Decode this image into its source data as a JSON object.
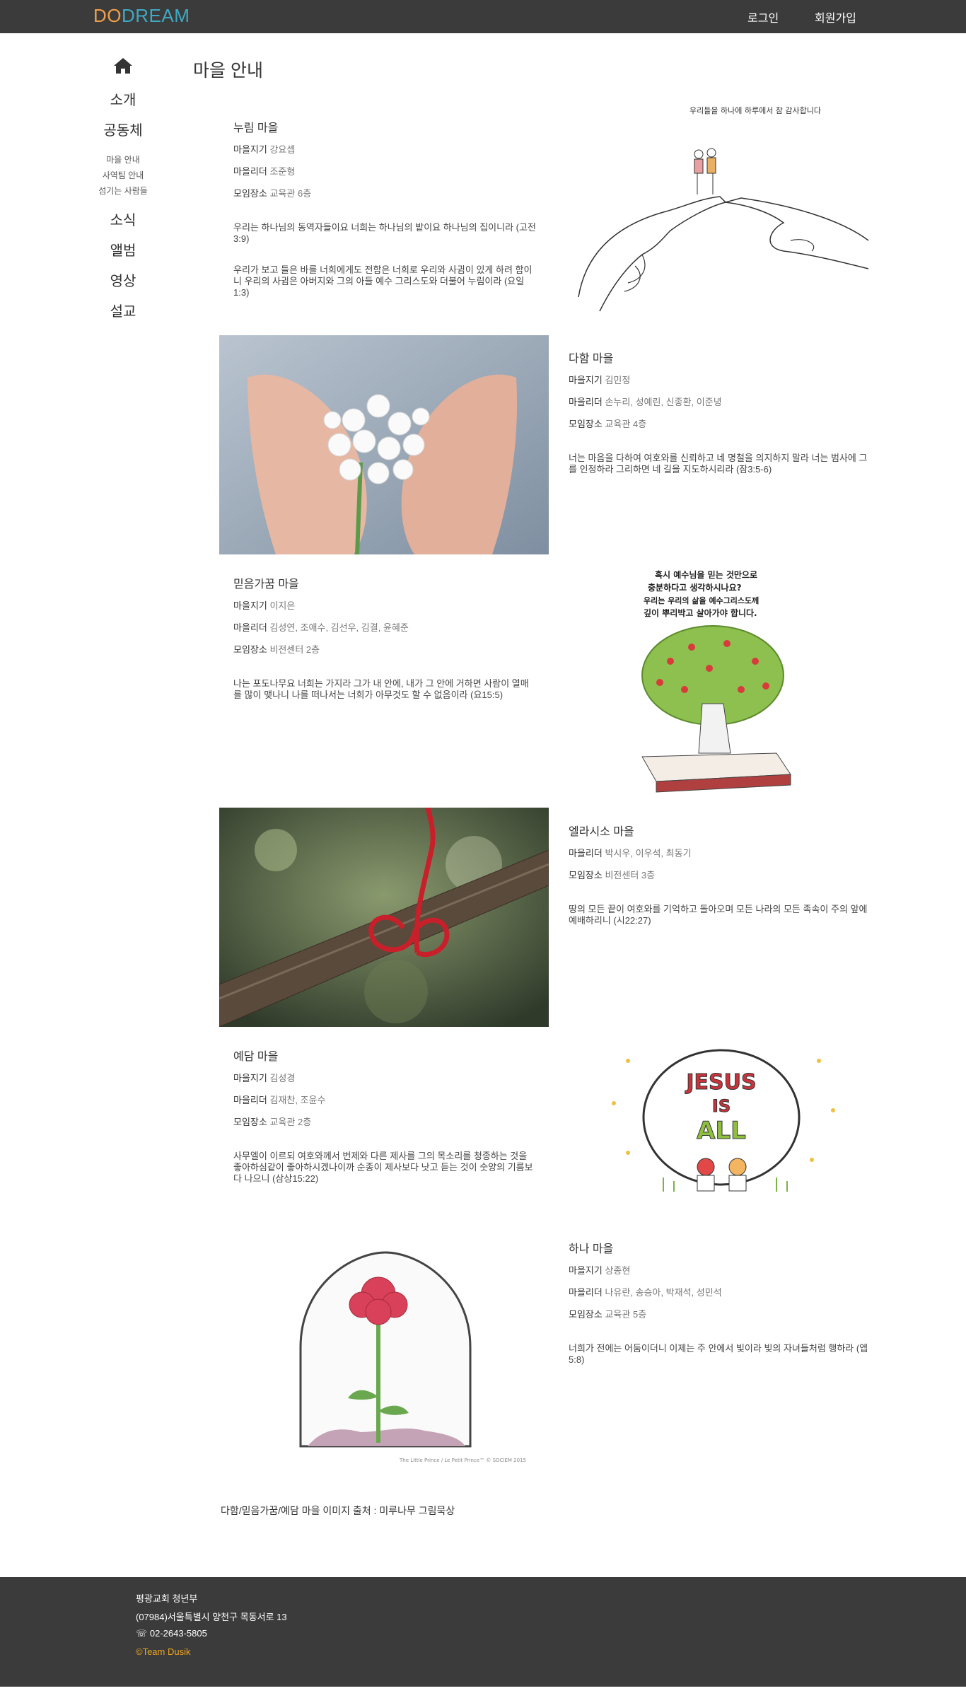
{
  "nav": {
    "logo_part1": "DO",
    "logo_part2": "DREAM",
    "login": "로그인",
    "signup": "회원가입"
  },
  "sidebar": {
    "home_icon": "home-icon",
    "items": [
      {
        "label": "소개"
      },
      {
        "label": "공동체"
      },
      {
        "label": "소식"
      },
      {
        "label": "앨범"
      },
      {
        "label": "영상"
      },
      {
        "label": "설교"
      }
    ],
    "sub": [
      {
        "label": "마을 안내"
      },
      {
        "label": "사역팀 안내"
      },
      {
        "label": "섬기는 사람들"
      }
    ]
  },
  "page_title": "마을 안내",
  "labels": {
    "leader1": "마을지기",
    "leader2": "마을리더",
    "place": "모임장소"
  },
  "villages": [
    {
      "name": "누림 마을",
      "keeper": "강요셉",
      "leaders": "조준형",
      "place": "교육관 6층",
      "verse1": "우리는 하나님의 동역자들이요 너희는 하나님의 밭이요 하나님의 집이니라 (고전3:9)",
      "verse2": "우리가 보고 들은 바를 너희에게도 전함은 너희로 우리와 사귐이 있게 하려 함이니 우리의 사귐은 아버지와 그의 아들 예수 그리스도와 더불어 누림이라 (요일1:3)"
    },
    {
      "name": "다함 마을",
      "keeper": "김민정",
      "leaders": "손누리, 성예린, 신종환, 이준녕",
      "place": "교육관 4층",
      "verse1": "너는 마음을 다하여 여호와를 신뢰하고 네 명철을 의지하지 말라 너는 범사에 그를 인정하라 그리하면 네 길을 지도하시리라 (잠3:5-6)"
    },
    {
      "name": "믿음가꿈 마을",
      "keeper": "이지은",
      "leaders": "김성연, 조애수, 김선우, 김결, 윤혜준",
      "place": "비전센터 2층",
      "verse1": "나는 포도나무요 너희는 가지라 그가 내 안에, 내가 그 안에 거하면 사람이 열매를 많이 맺나니 나를 떠나서는 너희가 아무것도 할 수 없음이라 (요15:5)"
    },
    {
      "name": "엘라시소 마을",
      "leaders": "박시우, 이우석, 최동기",
      "place": "비전센터 3층",
      "verse1": "땅의 모든 끝이 여호와를 기억하고 돌아오며 모든 나라의 모든 족속이 주의 앞에 예배하리니 (시22:27)"
    },
    {
      "name": "예담 마을",
      "keeper": "김성경",
      "leaders": "김재찬, 조윤수",
      "place": "교육관 2층",
      "verse1": "사무엘이 이르되 여호와께서 번제와 다른 제사를 그의 목소리를 청종하는 것을 좋아하심같이 좋아하시겠나이까 순종이 제사보다 낫고 듣는 것이 숫양의 기름보다 나으니 (삼상15:22)"
    },
    {
      "name": "하나 마을",
      "keeper": "상종현",
      "leaders": "나유란, 송승아, 박재석, 성민석",
      "place": "교육관 5층",
      "verse1": "너희가 전에는 어둠이더니 이제는 주 안에서 빛이라 빛의 자녀들처럼 행하라 (엡5:8)"
    }
  ],
  "images": {
    "handwriting_1": "우리들을 하나에 하루에서 참 감사합니다",
    "handwriting_3a": "혹시 예수님을 믿는 것만으로",
    "handwriting_3b": "충분하다고 생각하시나요?",
    "handwriting_3c": "우리는 우리의 삶을 예수그리스도께",
    "handwriting_3d": "깊이 뿌리박고 살아가야 합니다.",
    "jesus_line1": "JESUS",
    "jesus_line2": "IS",
    "jesus_line3": "ALL",
    "rose_caption": "The Little Prince / Le Petit Prince™ © SOCIEM 2015"
  },
  "credit": "다함/믿음가꿈/예담 마을 이미지 출처 : 미루나무 그림묵상",
  "footer": {
    "org": "평광교회 청년부",
    "address": "(07984)서울특별시 양천구 목동서로 13",
    "phone": "02-2643-5805",
    "team": "©Team Dusik"
  },
  "colors": {
    "nav_bg": "#3b3b3b",
    "logo_orange": "#f0a04a",
    "logo_teal": "#3ea9c3",
    "team_accent": "#f0a520"
  }
}
